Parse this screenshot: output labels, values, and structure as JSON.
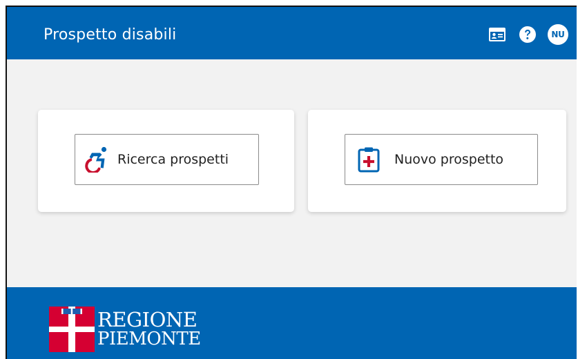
{
  "header": {
    "title": "Prospetto disabili",
    "icons": [
      "id-card-icon",
      "help-icon"
    ],
    "user_initials": "NU"
  },
  "cards": [
    {
      "label": "Ricerca prospetti",
      "icon": "accessible-icon"
    },
    {
      "label": "Nuovo prospetto",
      "icon": "clipboard-add-icon"
    }
  ],
  "footer": {
    "logo_line1": "REGIONE",
    "logo_line2": "PIEMONTE"
  },
  "colors": {
    "brand_blue": "#0065b3",
    "accent_red": "#c8102e",
    "background": "#f2f2f2"
  }
}
